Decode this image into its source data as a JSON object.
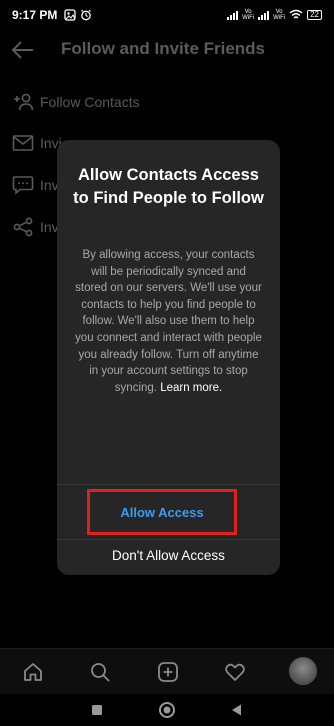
{
  "status_bar": {
    "time": "9:17 PM",
    "network_1": "Vo\nWiFi",
    "network_2": "Vo\nWiFi",
    "battery": "22"
  },
  "header": {
    "title": "Follow and Invite Friends",
    "back_icon": "arrow-left-icon"
  },
  "menu": {
    "items": [
      {
        "label": "Follow Contacts",
        "icon": "add-person-icon"
      },
      {
        "label": "Invi",
        "icon": "mail-icon"
      },
      {
        "label": "Inv",
        "icon": "chat-bubble-icon"
      },
      {
        "label": "Inv",
        "icon": "share-icon"
      }
    ]
  },
  "dialog": {
    "title": "Allow Contacts Access to Find People to Follow",
    "body": "By allowing access, your contacts will be periodically synced and stored on our servers. We'll use your contacts to help you find people to follow. We'll also use them to help you connect and interact with people you already follow. Turn off anytime in your account settings to stop syncing.",
    "learn_more": "Learn more.",
    "allow_label": "Allow Access",
    "deny_label": "Don't Allow Access",
    "accent_color": "#3b9cf3",
    "highlight_color": "#e0201f"
  },
  "tabbar": {
    "tabs": [
      "home-icon",
      "search-icon",
      "create-post-icon",
      "heart-icon",
      "profile-avatar"
    ]
  },
  "navbar": {
    "buttons": [
      "recents-square-icon",
      "home-circle-icon",
      "back-triangle-icon"
    ]
  }
}
